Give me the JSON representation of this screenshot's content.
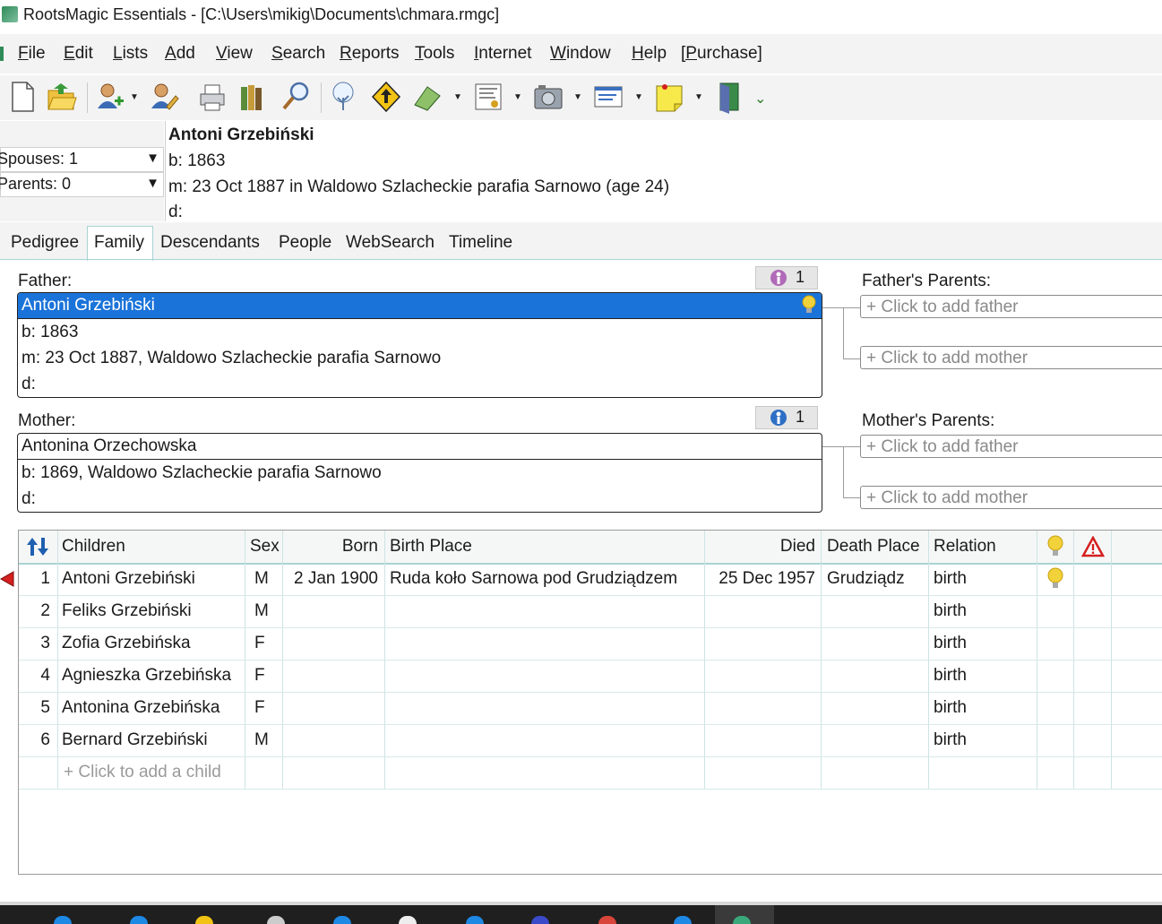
{
  "window": {
    "title": "RootsMagic Essentials - [C:\\Users\\mikig\\Documents\\chmara.rmgc]"
  },
  "menu": [
    {
      "u": "F",
      "rest": "ile"
    },
    {
      "u": "E",
      "rest": "dit"
    },
    {
      "u": "L",
      "rest": "ists"
    },
    {
      "u": "A",
      "rest": "dd"
    },
    {
      "u": "V",
      "rest": "iew"
    },
    {
      "u": "S",
      "rest": "earch"
    },
    {
      "u": "R",
      "rest": "eports"
    },
    {
      "u": "T",
      "rest": "ools"
    },
    {
      "u": "I",
      "rest": "nternet"
    },
    {
      "u": "W",
      "rest": "indow"
    },
    {
      "u": "H",
      "rest": "elp"
    },
    {
      "u": "[P",
      "rest": "urchase]"
    }
  ],
  "toolbar": {
    "icons": [
      "new-file-icon",
      "open-folder-icon",
      "add-person-icon",
      "edit-person-icon",
      "print-icon",
      "books-icon",
      "search-magnifier-icon",
      "tree-icon",
      "navigate-up-icon",
      "book-publisher-icon",
      "certificate-icon",
      "media-camera-icon",
      "screen-card-icon",
      "sticky-note-icon",
      "exit-door-icon",
      "more-chevron-icon"
    ]
  },
  "info": {
    "spouses": "Spouses: 1",
    "parents": "Parents: 0",
    "name": "Antoni Grzebiński",
    "birth": "b: 1863",
    "marriage": "m: 23 Oct 1887 in Waldowo Szlacheckie parafia Sarnowo (age 24)",
    "death": "d:"
  },
  "tabs": [
    "Pedigree",
    "Family",
    "Descendants",
    "People",
    "WebSearch",
    "Timeline"
  ],
  "family": {
    "father_label": "Father:",
    "father_badge": "1",
    "father": {
      "name": "Antoni Grzebiński",
      "birth": "b: 1863",
      "marriage": "m: 23 Oct 1887, Waldowo Szlacheckie parafia Sarnowo",
      "death": "d:"
    },
    "mother_label": "Mother:",
    "mother_badge": "1",
    "mother": {
      "name": "Antonina Orzechowska",
      "birth": "b: 1869, Waldowo Szlacheckie parafia Sarnowo",
      "death": "d:"
    },
    "fathers_parents_label": "Father's Parents:",
    "mothers_parents_label": "Mother's Parents:",
    "add_father": "+ Click to add father",
    "add_mother": "+ Click to add mother"
  },
  "children": {
    "headers": {
      "children": "Children",
      "sex": "Sex",
      "born": "Born",
      "birth_place": "Birth Place",
      "died": "Died",
      "death_place": "Death Place",
      "relation": "Relation"
    },
    "rows": [
      {
        "num": "1",
        "name": "Antoni Grzebiński",
        "sex": "M",
        "born": "2 Jan 1900",
        "birth_place": "Ruda koło Sarnowa pod Grudziądzem",
        "died": "25 Dec 1957",
        "death_place": "Grudziądz",
        "relation": "birth",
        "hint": true
      },
      {
        "num": "2",
        "name": "Feliks Grzebiński",
        "sex": "M",
        "born": "",
        "birth_place": "",
        "died": "",
        "death_place": "",
        "relation": "birth",
        "hint": false
      },
      {
        "num": "3",
        "name": "Zofia Grzebińska",
        "sex": "F",
        "born": "",
        "birth_place": "",
        "died": "",
        "death_place": "",
        "relation": "birth",
        "hint": false
      },
      {
        "num": "4",
        "name": "Agnieszka Grzebińska",
        "sex": "F",
        "born": "",
        "birth_place": "",
        "died": "",
        "death_place": "",
        "relation": "birth",
        "hint": false
      },
      {
        "num": "5",
        "name": "Antonina Grzebińska",
        "sex": "F",
        "born": "",
        "birth_place": "",
        "died": "",
        "death_place": "",
        "relation": "birth",
        "hint": false
      },
      {
        "num": "6",
        "name": "Bernard Grzebiński",
        "sex": "M",
        "born": "",
        "birth_place": "",
        "died": "",
        "death_place": "",
        "relation": "birth",
        "hint": false
      }
    ],
    "add_child": "+ Click to add a child"
  },
  "colors": {
    "selection": "#1a73d9",
    "accent_teal": "#a9d3d3",
    "warning": "#d42020",
    "hint": "#f2d23a"
  }
}
